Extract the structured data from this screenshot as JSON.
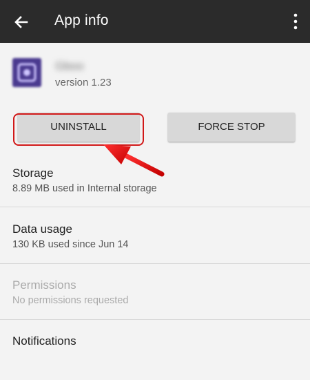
{
  "appbar": {
    "back_icon": "arrow-left-icon",
    "title": "App info",
    "overflow_icon": "more-vert-icon"
  },
  "app": {
    "name": "Gboo",
    "version": "version 1.23",
    "icon_color": "#4a3a8f"
  },
  "buttons": {
    "uninstall": "UNINSTALL",
    "force_stop": "FORCE STOP"
  },
  "annotation": {
    "highlight_color": "#d11818"
  },
  "settings": [
    {
      "title": "Storage",
      "subtitle": "8.89 MB used in Internal storage",
      "enabled": true
    },
    {
      "title": "Data usage",
      "subtitle": "130 KB used since Jun 14",
      "enabled": true
    },
    {
      "title": "Permissions",
      "subtitle": "No permissions requested",
      "enabled": false
    },
    {
      "title": "Notifications",
      "subtitle": "",
      "enabled": true
    }
  ]
}
